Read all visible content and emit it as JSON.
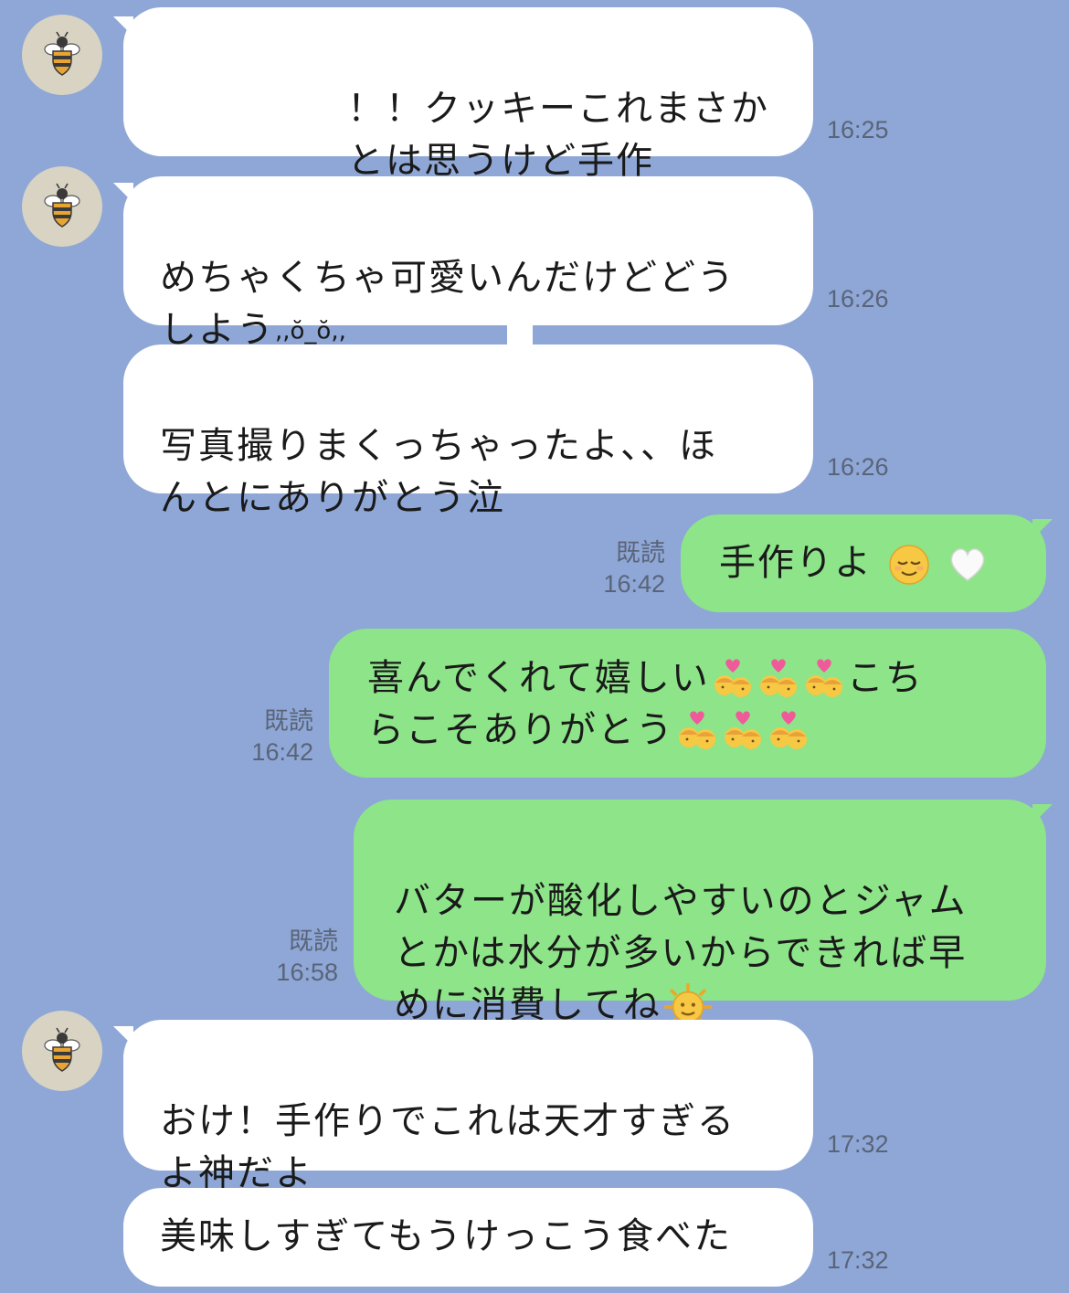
{
  "colors": {
    "background": "#8ea7d6",
    "incoming_bubble": "#ffffff",
    "outgoing_bubble": "#8de489",
    "meta_text": "#5a6478"
  },
  "avatar_icon": "bee-icon",
  "messages": [
    {
      "direction": "incoming",
      "text": "！！クッキーこれまさか\nとは思うけど手作り！？？？？",
      "time": "16:25"
    },
    {
      "direction": "incoming",
      "text": "めちゃくちゃ可愛いんだけどどう\nしよう",
      "kaomoji": ",,ŏ_ŏ,,",
      "time": "16:26"
    },
    {
      "direction": "incoming",
      "text": "写真撮りまくっちゃったよ、、ほ\nんとにありがとう泣",
      "time": "16:26"
    },
    {
      "direction": "outgoing",
      "text": "手作りよ",
      "emojis": [
        "relieved-face-emoji",
        "white-heart-emoji"
      ],
      "read": "既読",
      "time": "16:42"
    },
    {
      "direction": "outgoing",
      "text_line1": "喜んでくれて嬉しい",
      "text_line1b": "こち",
      "text_line2": "らこそありがとう",
      "emojis": [
        "kiss-woman-woman-emoji"
      ],
      "read": "既読",
      "time": "16:42"
    },
    {
      "direction": "outgoing",
      "text": "バターが酸化しやすいのとジャム\nとかは水分が多いからできれば早\nめに消費してね",
      "emojis": [
        "sun-with-face-emoji"
      ],
      "read": "既読",
      "time": "16:58"
    },
    {
      "direction": "incoming",
      "text": "おけ！手作りでこれは天才すぎる\nよ神だよ",
      "time": "17:32"
    },
    {
      "direction": "incoming",
      "text": "美味しすぎてもうけっこう食べた",
      "time": "17:32"
    }
  ]
}
